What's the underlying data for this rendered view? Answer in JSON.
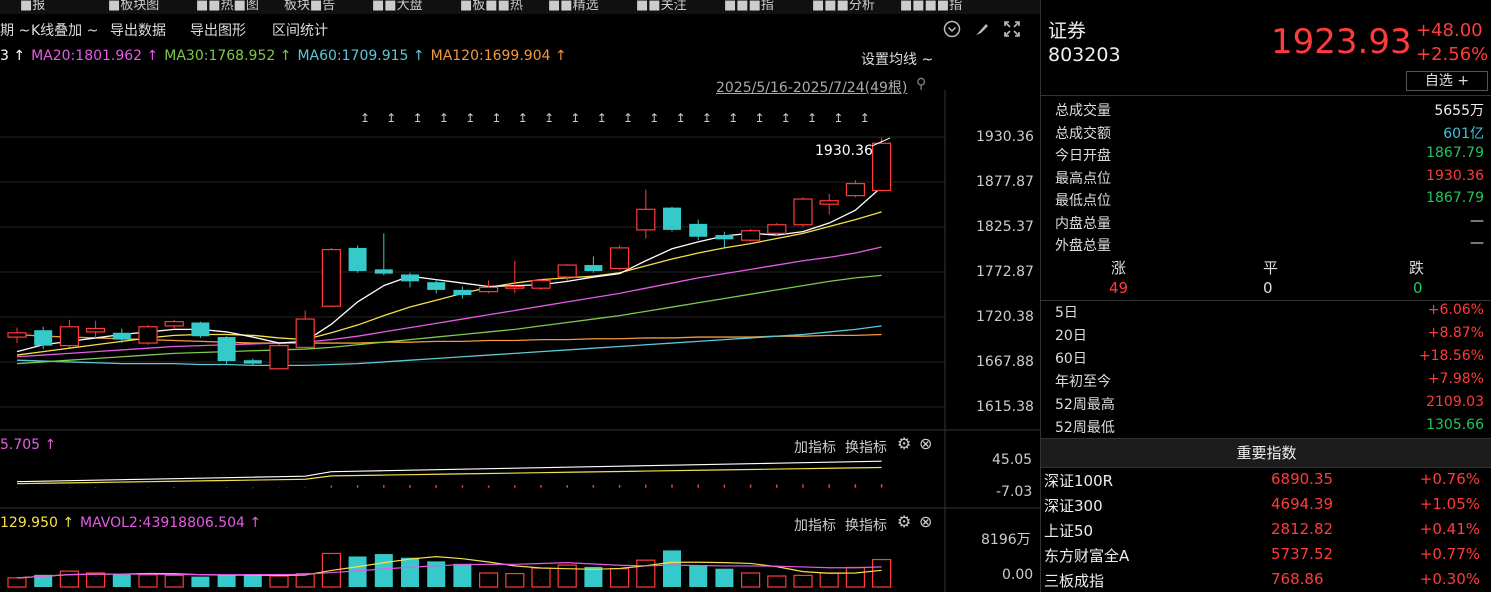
{
  "nav": {
    "tabs": [
      "■报",
      "■板块图",
      "■■热■图",
      "板块■告",
      "■■大盘",
      "■板■■热",
      "■■精选",
      "■■关注",
      "■■■指",
      "■■■分析",
      "■■■■指"
    ]
  },
  "toolbar": {
    "period_label": "期 ~",
    "kline_overlay": "K线叠加 ~",
    "export_data": "导出数据",
    "export_chart": "导出图形",
    "range_stats": "区间统计"
  },
  "ma_legend": {
    "items": [
      {
        "text": "3 ↑",
        "color": "#ffffff"
      },
      {
        "text": "MA20:1801.962 ↑",
        "color": "#e55be5"
      },
      {
        "text": "MA30:1768.952 ↑",
        "color": "#7ec84a"
      },
      {
        "text": "MA60:1709.915 ↑",
        "color": "#5bc8d8"
      },
      {
        "text": "MA120:1699.904 ↑",
        "color": "#f29a3a"
      }
    ],
    "settings": "设置均线 ~"
  },
  "range": {
    "text": "2025/5/16-2025/7/24(49根)"
  },
  "price_axis": [
    "1930.36",
    "1877.87",
    "1825.37",
    "1772.87",
    "1720.38",
    "1667.88",
    "1615.38"
  ],
  "high_label": "1930.36",
  "macd_panel": {
    "value_text": "5.705 ↑",
    "add": "加指标",
    "swap": "换指标",
    "axis": [
      "45.05",
      "-7.03"
    ]
  },
  "vol_panel": {
    "legend1": "129.950 ↑",
    "legend2": "MAVOL2:43918806.504 ↑",
    "add": "加指标",
    "swap": "换指标",
    "axis": [
      "8196万",
      "0.00"
    ]
  },
  "chart_data": {
    "type": "candlestick",
    "ylim": [
      1605,
      1945
    ],
    "candles": [
      {
        "o": 1702,
        "c": 1697,
        "h": 1708,
        "l": 1690,
        "up": true
      },
      {
        "o": 1687,
        "c": 1705,
        "h": 1709,
        "l": 1683,
        "up": false
      },
      {
        "o": 1687,
        "c": 1709,
        "h": 1717,
        "l": 1685,
        "up": true
      },
      {
        "o": 1707,
        "c": 1703,
        "h": 1716,
        "l": 1696,
        "up": true
      },
      {
        "o": 1702,
        "c": 1694,
        "h": 1707,
        "l": 1690,
        "up": false
      },
      {
        "o": 1690,
        "c": 1709,
        "h": 1711,
        "l": 1688,
        "up": true
      },
      {
        "o": 1710,
        "c": 1715,
        "h": 1717,
        "l": 1706,
        "up": true
      },
      {
        "o": 1714,
        "c": 1698,
        "h": 1715,
        "l": 1696,
        "up": false
      },
      {
        "o": 1697,
        "c": 1669,
        "h": 1698,
        "l": 1665,
        "up": false
      },
      {
        "o": 1670,
        "c": 1666,
        "h": 1672,
        "l": 1664,
        "up": false
      },
      {
        "o": 1660,
        "c": 1687,
        "h": 1689,
        "l": 1659,
        "up": true
      },
      {
        "o": 1685,
        "c": 1718,
        "h": 1728,
        "l": 1684,
        "up": true
      },
      {
        "o": 1733,
        "c": 1799,
        "h": 1801,
        "l": 1732,
        "up": true
      },
      {
        "o": 1801,
        "c": 1774,
        "h": 1804,
        "l": 1772,
        "up": false
      },
      {
        "o": 1776,
        "c": 1771,
        "h": 1818,
        "l": 1769,
        "up": false
      },
      {
        "o": 1770,
        "c": 1762,
        "h": 1772,
        "l": 1755,
        "up": false
      },
      {
        "o": 1761,
        "c": 1752,
        "h": 1764,
        "l": 1748,
        "up": false
      },
      {
        "o": 1752,
        "c": 1746,
        "h": 1756,
        "l": 1742,
        "up": false
      },
      {
        "o": 1750,
        "c": 1755,
        "h": 1763,
        "l": 1748,
        "up": true
      },
      {
        "o": 1754,
        "c": 1756,
        "h": 1786,
        "l": 1748,
        "up": true
      },
      {
        "o": 1754,
        "c": 1763,
        "h": 1765,
        "l": 1752,
        "up": true
      },
      {
        "o": 1767,
        "c": 1781,
        "h": 1782,
        "l": 1763,
        "up": true
      },
      {
        "o": 1781,
        "c": 1774,
        "h": 1791,
        "l": 1772,
        "up": false
      },
      {
        "o": 1777,
        "c": 1801,
        "h": 1804,
        "l": 1775,
        "up": true
      },
      {
        "o": 1822,
        "c": 1846,
        "h": 1869,
        "l": 1812,
        "up": true
      },
      {
        "o": 1848,
        "c": 1822,
        "h": 1849,
        "l": 1820,
        "up": false
      },
      {
        "o": 1829,
        "c": 1814,
        "h": 1834,
        "l": 1810,
        "up": false
      },
      {
        "o": 1816,
        "c": 1811,
        "h": 1820,
        "l": 1802,
        "up": false
      },
      {
        "o": 1810,
        "c": 1821,
        "h": 1823,
        "l": 1808,
        "up": true
      },
      {
        "o": 1818,
        "c": 1828,
        "h": 1830,
        "l": 1815,
        "up": true
      },
      {
        "o": 1828,
        "c": 1858,
        "h": 1860,
        "l": 1826,
        "up": true
      },
      {
        "o": 1852,
        "c": 1856,
        "h": 1864,
        "l": 1840,
        "up": true
      },
      {
        "o": 1862,
        "c": 1876,
        "h": 1880,
        "l": 1860,
        "up": true
      },
      {
        "o": 1868,
        "c": 1923,
        "h": 1930,
        "l": 1867,
        "up": true
      }
    ],
    "ma5": [
      1680,
      1688,
      1692,
      1696,
      1700,
      1703,
      1706,
      1706,
      1703,
      1697,
      1690,
      1692,
      1712,
      1738,
      1757,
      1768,
      1764,
      1760,
      1756,
      1757,
      1758,
      1762,
      1767,
      1771,
      1786,
      1800,
      1808,
      1815,
      1818,
      1816,
      1820,
      1830,
      1845,
      1872
    ],
    "ma10": [
      1676,
      1680,
      1684,
      1688,
      1692,
      1696,
      1699,
      1700,
      1700,
      1699,
      1696,
      1694,
      1702,
      1711,
      1722,
      1732,
      1740,
      1748,
      1755,
      1760,
      1764,
      1766,
      1768,
      1772,
      1780,
      1788,
      1795,
      1801,
      1806,
      1812,
      1818,
      1826,
      1834,
      1843
    ],
    "ma20": [
      1674,
      1676,
      1678,
      1680,
      1682,
      1684,
      1686,
      1687,
      1688,
      1689,
      1690,
      1691,
      1694,
      1698,
      1703,
      1708,
      1713,
      1718,
      1723,
      1728,
      1733,
      1738,
      1743,
      1748,
      1754,
      1760,
      1766,
      1771,
      1776,
      1781,
      1786,
      1790,
      1795,
      1802
    ],
    "ma30": [
      1666,
      1668,
      1670,
      1672,
      1674,
      1676,
      1678,
      1679,
      1680,
      1681,
      1682,
      1683,
      1685,
      1688,
      1691,
      1694,
      1697,
      1700,
      1703,
      1706,
      1710,
      1714,
      1718,
      1722,
      1727,
      1732,
      1737,
      1742,
      1747,
      1752,
      1757,
      1762,
      1766,
      1769
    ],
    "ma60": [
      1670,
      1669,
      1668,
      1667,
      1666,
      1666,
      1666,
      1665,
      1665,
      1664,
      1664,
      1664,
      1665,
      1666,
      1668,
      1670,
      1672,
      1674,
      1676,
      1678,
      1680,
      1682,
      1684,
      1686,
      1688,
      1690,
      1692,
      1694,
      1696,
      1698,
      1700,
      1703,
      1706,
      1710
    ],
    "ma120": [
      1700,
      1698,
      1697,
      1696,
      1695,
      1694,
      1693,
      1692,
      1691,
      1690,
      1690,
      1690,
      1690,
      1690,
      1691,
      1691,
      1692,
      1692,
      1693,
      1693,
      1694,
      1694,
      1695,
      1695,
      1696,
      1696,
      1697,
      1697,
      1697,
      1698,
      1698,
      1699,
      1699,
      1700
    ],
    "volume_wan": [
      1500,
      2000,
      2600,
      2300,
      2200,
      2000,
      1900,
      1700,
      2000,
      2100,
      1800,
      2200,
      5500,
      5000,
      5400,
      4800,
      4200,
      3800,
      2300,
      2200,
      3100,
      3600,
      3300,
      3000,
      4400,
      6000,
      3600,
      3000,
      2300,
      1800,
      1900,
      2300,
      3200,
      4500
    ],
    "volume_ylim": [
      0,
      8196
    ],
    "macd_hist": [
      0.5,
      0.3,
      0.5,
      0.8,
      0.4,
      0.6,
      0.9,
      0.3,
      -0.5,
      -0.8,
      -0.3,
      0.5,
      3.5,
      4,
      4.2,
      4.3,
      4,
      3.8,
      3.6,
      3.8,
      4,
      4.2,
      4.3,
      4.5,
      4.8,
      5,
      5,
      4.9,
      5,
      5.1,
      5.3,
      5.5,
      5.6,
      5.8
    ],
    "macd_ylim": [
      -7.03,
      45.05
    ]
  },
  "quote": {
    "name": "证券",
    "code": "803203",
    "price": "1923.93",
    "change": "+48.00",
    "change_pct": "+2.56%",
    "watch_btn": "自选 +"
  },
  "stats": [
    {
      "k": "总成交量",
      "v": "5655万",
      "c": "white"
    },
    {
      "k": "总成交额",
      "v": "601亿",
      "c": "cyan"
    },
    {
      "k": "今日开盘",
      "v": "1867.79",
      "c": "green"
    },
    {
      "k": "最高点位",
      "v": "1930.36",
      "c": "red"
    },
    {
      "k": "最低点位",
      "v": "1867.79",
      "c": "green"
    },
    {
      "k": "内盘总量",
      "v": "—",
      "c": "white"
    },
    {
      "k": "外盘总量",
      "v": "—",
      "c": "white"
    }
  ],
  "breadth": {
    "up_label": "涨",
    "flat_label": "平",
    "down_label": "跌",
    "up": "49",
    "flat": "0",
    "down": "0"
  },
  "periods": [
    {
      "k": "5日",
      "v": "+6.06%",
      "c": "red"
    },
    {
      "k": "20日",
      "v": "+8.87%",
      "c": "red"
    },
    {
      "k": "60日",
      "v": "+18.56%",
      "c": "red"
    },
    {
      "k": "年初至今",
      "v": "+7.98%",
      "c": "red"
    },
    {
      "k": "52周最高",
      "v": "2109.03",
      "c": "red"
    },
    {
      "k": "52周最低",
      "v": "1305.66",
      "c": "green"
    }
  ],
  "index_header": "重要指数",
  "indices": [
    {
      "name": "深证100R",
      "price": "6890.35",
      "pct": "+0.76%"
    },
    {
      "name": "深证300",
      "price": "4694.39",
      "pct": "+1.05%"
    },
    {
      "name": "上证50",
      "price": "2812.82",
      "pct": "+0.41%"
    },
    {
      "name": "东方财富全A",
      "price": "5737.52",
      "pct": "+0.77%"
    },
    {
      "name": "三板成指",
      "price": "768.86",
      "pct": "+0.30%"
    }
  ]
}
